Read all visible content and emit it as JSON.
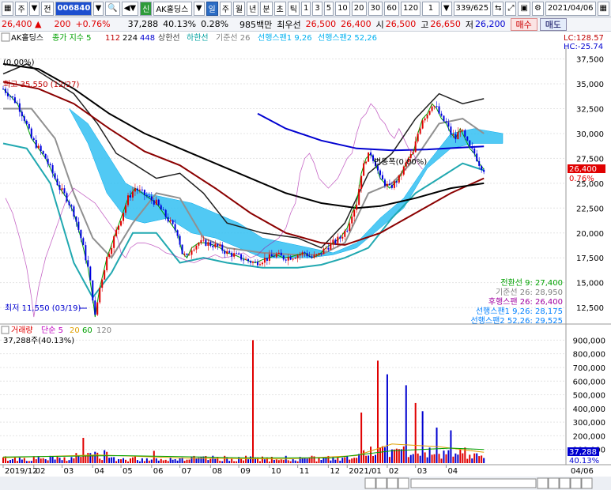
{
  "toolbar": {
    "menu_label": "주",
    "jeon_label": "전",
    "code": "006840",
    "stock_name": "AK홀딩스",
    "sin_badge": "신",
    "periods": [
      "일",
      "주",
      "월",
      "년",
      "분",
      "초",
      "틱"
    ],
    "minutes": [
      "1",
      "3",
      "5",
      "10",
      "20",
      "30",
      "60",
      "120"
    ],
    "unit": "1",
    "count": "339/625",
    "date": "2021/04/06"
  },
  "quote": {
    "last_price": "26,400",
    "change": "200",
    "change_pct": "+0.76%",
    "volume": "37,288",
    "volume_ratio": "40.13%",
    "turnover_rate": "0.28%",
    "amount": "985백만",
    "best_ask_label": "최우선",
    "best_ask": "26,500",
    "best_bid": "26,400",
    "open_label": "시",
    "open": "26,500",
    "high_label": "고",
    "high": "26,650",
    "low_label": "저",
    "low": "26,200",
    "buy_label": "매수",
    "sell_label": "매도"
  },
  "price_legend": {
    "name": "AK홀딩스",
    "items": [
      {
        "label": "종가 지수 5",
        "color": "#00a000"
      },
      {
        "label": "112",
        "color": "#c00000"
      },
      {
        "label": "224",
        "color": "#000000"
      },
      {
        "label": "448",
        "color": "#0000d0"
      },
      {
        "label": "상한선",
        "color": "#404040"
      },
      {
        "label": "하한선",
        "color": "#00a0a0"
      },
      {
        "label": "기준선 26",
        "color": "#808080"
      },
      {
        "label": "선행스팬1 9,26",
        "color": "#00b0f0"
      },
      {
        "label": "선행스팬2 52,26",
        "color": "#00b0f0"
      }
    ],
    "lc": "LC:128.57",
    "hc": "HC:-25.74",
    "pct_zero": "(0.00%)"
  },
  "annotations": {
    "high_mark": "최고 35,550 (12/27)",
    "low_mark": "최저 11,550 (03/19)",
    "mid_mark": "변동폭(0.00%)",
    "current_price": "26,400",
    "current_pct": "0.76%"
  },
  "indicator_values": [
    {
      "text": "전환선 9: 27,400",
      "color": "#00a000"
    },
    {
      "text": "기준선 26: 28,950",
      "color": "#808080"
    },
    {
      "text": "후행스팬 26: 26,400",
      "color": "#a000a0"
    },
    {
      "text": "선행스팬1 9,26: 28,175",
      "color": "#0080ff"
    },
    {
      "text": "선행스팬2 52,26: 29,525",
      "color": "#0080ff"
    }
  ],
  "volume_legend": {
    "items": [
      {
        "label": "거래량",
        "color": "#e00000"
      },
      {
        "label": "단순 5",
        "color": "#c000c0"
      },
      {
        "label": "20",
        "color": "#e0a000"
      },
      {
        "label": "60",
        "color": "#00a000"
      },
      {
        "label": "120",
        "color": "#808080"
      }
    ],
    "current": "37,288주(40.13%)",
    "box_value": "37,288",
    "box_pct": "40.13%"
  },
  "xaxis_labels": [
    "2019/12",
    "02",
    "03",
    "04",
    "05",
    "06",
    "07",
    "08",
    "09",
    "10",
    "11",
    "12",
    "2021/01",
    "02",
    "03",
    "04"
  ],
  "xaxis_right": "04/06",
  "chart_data": {
    "type": "line",
    "price_axis": {
      "ylim": [
        11000,
        38500
      ],
      "ticks": [
        37500,
        35000,
        32500,
        30000,
        27500,
        25000,
        22500,
        20000,
        17500,
        15000,
        12500
      ]
    },
    "price_tick_labels": [
      "37,500",
      "35,000",
      "32,500",
      "30,000",
      "27,500",
      "25,000",
      "22,500",
      "20,000",
      "17,500",
      "15,000",
      "12,500"
    ],
    "volume_axis": {
      "ylim": [
        0,
        960000
      ],
      "ticks": [
        900000,
        800000,
        700000,
        600000,
        500000,
        400000,
        300000,
        200000,
        100000
      ]
    },
    "volume_tick_labels": [
      "900,000",
      "800,000",
      "700,000",
      "600,000",
      "500,000",
      "400,000",
      "300,000",
      "200,000",
      "100,000"
    ],
    "close_series": [
      [
        0,
        34500
      ],
      [
        3,
        33800
      ],
      [
        6,
        33000
      ],
      [
        9,
        31500
      ],
      [
        12,
        29500
      ],
      [
        15,
        28500
      ],
      [
        18,
        27500
      ],
      [
        21,
        26000
      ],
      [
        24,
        24500
      ],
      [
        27,
        23500
      ],
      [
        30,
        22000
      ],
      [
        33,
        19500
      ],
      [
        36,
        16500
      ],
      [
        38,
        13500
      ],
      [
        39,
        11550
      ],
      [
        41,
        14500
      ],
      [
        44,
        17500
      ],
      [
        47,
        19500
      ],
      [
        50,
        21500
      ],
      [
        53,
        23500
      ],
      [
        56,
        24500
      ],
      [
        59,
        24000
      ],
      [
        62,
        23500
      ],
      [
        65,
        23000
      ],
      [
        68,
        22000
      ],
      [
        71,
        21000
      ],
      [
        74,
        20000
      ],
      [
        76,
        18000
      ],
      [
        78,
        17500
      ],
      [
        80,
        18500
      ],
      [
        83,
        19000
      ],
      [
        86,
        19000
      ],
      [
        89,
        18800
      ],
      [
        92,
        18500
      ],
      [
        95,
        18000
      ],
      [
        98,
        17800
      ],
      [
        101,
        17500
      ],
      [
        104,
        17200
      ],
      [
        107,
        17000
      ],
      [
        110,
        17300
      ],
      [
        113,
        17500
      ],
      [
        116,
        17800
      ],
      [
        119,
        17500
      ],
      [
        122,
        17600
      ],
      [
        125,
        17800
      ],
      [
        128,
        18000
      ],
      [
        131,
        17500
      ],
      [
        134,
        17800
      ],
      [
        137,
        18500
      ],
      [
        140,
        19000
      ],
      [
        143,
        19500
      ],
      [
        146,
        20500
      ],
      [
        148,
        22000
      ],
      [
        150,
        23000
      ],
      [
        152,
        26000
      ],
      [
        154,
        27500
      ],
      [
        156,
        28000
      ],
      [
        158,
        27000
      ],
      [
        160,
        25500
      ],
      [
        162,
        25000
      ],
      [
        164,
        24500
      ],
      [
        166,
        25000
      ],
      [
        168,
        25500
      ],
      [
        170,
        26500
      ],
      [
        172,
        27500
      ],
      [
        174,
        28000
      ],
      [
        176,
        30000
      ],
      [
        178,
        31500
      ],
      [
        180,
        32000
      ],
      [
        182,
        33000
      ],
      [
        184,
        32500
      ],
      [
        186,
        31500
      ],
      [
        188,
        31000
      ],
      [
        190,
        30000
      ],
      [
        192,
        29500
      ],
      [
        194,
        30500
      ],
      [
        196,
        29500
      ],
      [
        198,
        28500
      ],
      [
        200,
        28000
      ],
      [
        202,
        27000
      ],
      [
        204,
        26400
      ]
    ],
    "series": [
      {
        "name": "112",
        "color": "#8b0000",
        "points": [
          [
            0,
            35200
          ],
          [
            15,
            34500
          ],
          [
            30,
            33000
          ],
          [
            45,
            30500
          ],
          [
            60,
            28200
          ],
          [
            75,
            26800
          ],
          [
            90,
            24500
          ],
          [
            105,
            22000
          ],
          [
            120,
            20000
          ],
          [
            135,
            19000
          ],
          [
            145,
            18800
          ],
          [
            160,
            20000
          ],
          [
            175,
            22000
          ],
          [
            190,
            24000
          ],
          [
            204,
            25500
          ]
        ]
      },
      {
        "name": "224",
        "color": "#000000",
        "points": [
          [
            0,
            37000
          ],
          [
            15,
            36500
          ],
          [
            30,
            34500
          ],
          [
            45,
            32000
          ],
          [
            60,
            30000
          ],
          [
            75,
            28500
          ],
          [
            90,
            27000
          ],
          [
            105,
            25500
          ],
          [
            120,
            24000
          ],
          [
            135,
            23000
          ],
          [
            150,
            22500
          ],
          [
            160,
            22700
          ],
          [
            175,
            23500
          ],
          [
            190,
            24500
          ],
          [
            204,
            25000
          ]
        ]
      },
      {
        "name": "448",
        "color": "#0000d0",
        "points": [
          [
            108,
            32000
          ],
          [
            120,
            30500
          ],
          [
            135,
            29300
          ],
          [
            150,
            28500
          ],
          [
            165,
            28300
          ],
          [
            180,
            28400
          ],
          [
            195,
            28600
          ],
          [
            204,
            28700
          ]
        ]
      }
    ],
    "bands": {
      "upper": [
        [
          0,
          36000
        ],
        [
          10,
          37000
        ],
        [
          20,
          35500
        ],
        [
          30,
          34000
        ],
        [
          40,
          31000
        ],
        [
          48,
          28000
        ],
        [
          55,
          27000
        ],
        [
          65,
          25500
        ],
        [
          75,
          26000
        ],
        [
          85,
          24000
        ],
        [
          95,
          21000
        ],
        [
          110,
          20000
        ],
        [
          125,
          19500
        ],
        [
          135,
          18500
        ],
        [
          145,
          21000
        ],
        [
          155,
          26000
        ],
        [
          165,
          28000
        ],
        [
          175,
          31500
        ],
        [
          185,
          34000
        ],
        [
          195,
          33000
        ],
        [
          204,
          33500
        ]
      ],
      "lower": [
        [
          0,
          29000
        ],
        [
          10,
          28500
        ],
        [
          20,
          25000
        ],
        [
          30,
          17000
        ],
        [
          38,
          13500
        ],
        [
          46,
          16000
        ],
        [
          55,
          20000
        ],
        [
          65,
          20000
        ],
        [
          75,
          17000
        ],
        [
          85,
          17500
        ],
        [
          95,
          17000
        ],
        [
          110,
          16500
        ],
        [
          125,
          16500
        ],
        [
          135,
          16800
        ],
        [
          145,
          17500
        ],
        [
          155,
          18500
        ],
        [
          165,
          21500
        ],
        [
          175,
          24000
        ],
        [
          185,
          25500
        ],
        [
          195,
          27000
        ],
        [
          204,
          26300
        ]
      ]
    },
    "base_line": [
      [
        0,
        32500
      ],
      [
        12,
        32500
      ],
      [
        22,
        29500
      ],
      [
        30,
        24000
      ],
      [
        38,
        19500
      ],
      [
        46,
        17500
      ],
      [
        55,
        21000
      ],
      [
        65,
        24000
      ],
      [
        75,
        23500
      ],
      [
        85,
        19500
      ],
      [
        95,
        18500
      ],
      [
        110,
        18000
      ],
      [
        125,
        17800
      ],
      [
        135,
        17800
      ],
      [
        145,
        19000
      ],
      [
        155,
        24000
      ],
      [
        165,
        25000
      ],
      [
        175,
        27500
      ],
      [
        185,
        31000
      ],
      [
        195,
        31500
      ],
      [
        204,
        30000
      ]
    ],
    "cloud": [
      [
        28,
        32500,
        32500
      ],
      [
        36,
        31000,
        29000
      ],
      [
        44,
        28000,
        24000
      ],
      [
        52,
        25000,
        21500
      ],
      [
        60,
        24000,
        21000
      ],
      [
        70,
        23500,
        21500
      ],
      [
        80,
        23000,
        20000
      ],
      [
        90,
        22000,
        19500
      ],
      [
        100,
        21000,
        18500
      ],
      [
        110,
        19500,
        17500
      ],
      [
        120,
        19000,
        17500
      ],
      [
        130,
        18500,
        17500
      ],
      [
        140,
        18000,
        17800
      ],
      [
        150,
        19000,
        18500
      ],
      [
        160,
        21500,
        20500
      ],
      [
        170,
        23500,
        22500
      ],
      [
        180,
        27000,
        26500
      ],
      [
        190,
        30000,
        28500
      ],
      [
        200,
        30500,
        29000
      ],
      [
        212,
        30000,
        29000
      ]
    ],
    "volume_series": [],
    "volume_peaks": [
      [
        106,
        900000
      ],
      [
        34,
        185000
      ],
      [
        64,
        90000
      ],
      [
        152,
        370000
      ],
      [
        159,
        750000
      ],
      [
        163,
        650000
      ],
      [
        171,
        570000
      ],
      [
        175,
        440000
      ],
      [
        178,
        380000
      ],
      [
        184,
        260000
      ],
      [
        190,
        240000
      ]
    ]
  }
}
